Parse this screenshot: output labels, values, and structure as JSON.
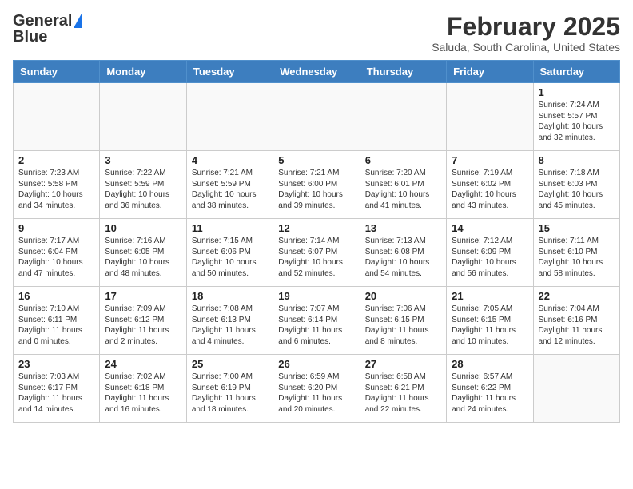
{
  "logo": {
    "text1": "General",
    "text2": "Blue"
  },
  "title": "February 2025",
  "location": "Saluda, South Carolina, United States",
  "days_of_week": [
    "Sunday",
    "Monday",
    "Tuesday",
    "Wednesday",
    "Thursday",
    "Friday",
    "Saturday"
  ],
  "weeks": [
    [
      {
        "day": "",
        "info": ""
      },
      {
        "day": "",
        "info": ""
      },
      {
        "day": "",
        "info": ""
      },
      {
        "day": "",
        "info": ""
      },
      {
        "day": "",
        "info": ""
      },
      {
        "day": "",
        "info": ""
      },
      {
        "day": "1",
        "info": "Sunrise: 7:24 AM\nSunset: 5:57 PM\nDaylight: 10 hours\nand 32 minutes."
      }
    ],
    [
      {
        "day": "2",
        "info": "Sunrise: 7:23 AM\nSunset: 5:58 PM\nDaylight: 10 hours\nand 34 minutes."
      },
      {
        "day": "3",
        "info": "Sunrise: 7:22 AM\nSunset: 5:59 PM\nDaylight: 10 hours\nand 36 minutes."
      },
      {
        "day": "4",
        "info": "Sunrise: 7:21 AM\nSunset: 5:59 PM\nDaylight: 10 hours\nand 38 minutes."
      },
      {
        "day": "5",
        "info": "Sunrise: 7:21 AM\nSunset: 6:00 PM\nDaylight: 10 hours\nand 39 minutes."
      },
      {
        "day": "6",
        "info": "Sunrise: 7:20 AM\nSunset: 6:01 PM\nDaylight: 10 hours\nand 41 minutes."
      },
      {
        "day": "7",
        "info": "Sunrise: 7:19 AM\nSunset: 6:02 PM\nDaylight: 10 hours\nand 43 minutes."
      },
      {
        "day": "8",
        "info": "Sunrise: 7:18 AM\nSunset: 6:03 PM\nDaylight: 10 hours\nand 45 minutes."
      }
    ],
    [
      {
        "day": "9",
        "info": "Sunrise: 7:17 AM\nSunset: 6:04 PM\nDaylight: 10 hours\nand 47 minutes."
      },
      {
        "day": "10",
        "info": "Sunrise: 7:16 AM\nSunset: 6:05 PM\nDaylight: 10 hours\nand 48 minutes."
      },
      {
        "day": "11",
        "info": "Sunrise: 7:15 AM\nSunset: 6:06 PM\nDaylight: 10 hours\nand 50 minutes."
      },
      {
        "day": "12",
        "info": "Sunrise: 7:14 AM\nSunset: 6:07 PM\nDaylight: 10 hours\nand 52 minutes."
      },
      {
        "day": "13",
        "info": "Sunrise: 7:13 AM\nSunset: 6:08 PM\nDaylight: 10 hours\nand 54 minutes."
      },
      {
        "day": "14",
        "info": "Sunrise: 7:12 AM\nSunset: 6:09 PM\nDaylight: 10 hours\nand 56 minutes."
      },
      {
        "day": "15",
        "info": "Sunrise: 7:11 AM\nSunset: 6:10 PM\nDaylight: 10 hours\nand 58 minutes."
      }
    ],
    [
      {
        "day": "16",
        "info": "Sunrise: 7:10 AM\nSunset: 6:11 PM\nDaylight: 11 hours\nand 0 minutes."
      },
      {
        "day": "17",
        "info": "Sunrise: 7:09 AM\nSunset: 6:12 PM\nDaylight: 11 hours\nand 2 minutes."
      },
      {
        "day": "18",
        "info": "Sunrise: 7:08 AM\nSunset: 6:13 PM\nDaylight: 11 hours\nand 4 minutes."
      },
      {
        "day": "19",
        "info": "Sunrise: 7:07 AM\nSunset: 6:14 PM\nDaylight: 11 hours\nand 6 minutes."
      },
      {
        "day": "20",
        "info": "Sunrise: 7:06 AM\nSunset: 6:15 PM\nDaylight: 11 hours\nand 8 minutes."
      },
      {
        "day": "21",
        "info": "Sunrise: 7:05 AM\nSunset: 6:15 PM\nDaylight: 11 hours\nand 10 minutes."
      },
      {
        "day": "22",
        "info": "Sunrise: 7:04 AM\nSunset: 6:16 PM\nDaylight: 11 hours\nand 12 minutes."
      }
    ],
    [
      {
        "day": "23",
        "info": "Sunrise: 7:03 AM\nSunset: 6:17 PM\nDaylight: 11 hours\nand 14 minutes."
      },
      {
        "day": "24",
        "info": "Sunrise: 7:02 AM\nSunset: 6:18 PM\nDaylight: 11 hours\nand 16 minutes."
      },
      {
        "day": "25",
        "info": "Sunrise: 7:00 AM\nSunset: 6:19 PM\nDaylight: 11 hours\nand 18 minutes."
      },
      {
        "day": "26",
        "info": "Sunrise: 6:59 AM\nSunset: 6:20 PM\nDaylight: 11 hours\nand 20 minutes."
      },
      {
        "day": "27",
        "info": "Sunrise: 6:58 AM\nSunset: 6:21 PM\nDaylight: 11 hours\nand 22 minutes."
      },
      {
        "day": "28",
        "info": "Sunrise: 6:57 AM\nSunset: 6:22 PM\nDaylight: 11 hours\nand 24 minutes."
      },
      {
        "day": "",
        "info": ""
      }
    ]
  ]
}
